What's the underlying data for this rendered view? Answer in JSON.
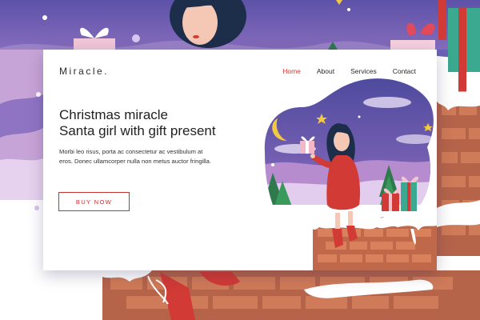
{
  "site": {
    "brand": "Miracle."
  },
  "nav": {
    "items": [
      {
        "label": "Home",
        "active": true
      },
      {
        "label": "About",
        "active": false
      },
      {
        "label": "Services",
        "active": false
      },
      {
        "label": "Contact",
        "active": false
      }
    ]
  },
  "hero": {
    "title_line1": "Christmas miracle",
    "title_line2": "Santa girl with gift present",
    "description": "Morbi leo risus, porta ac consectetur ac vestibulum at eros. Donec ullamcorper nulla non metus auctor fringilla.",
    "cta_label": "BUY NOW"
  },
  "colors": {
    "accent": "#d13a35",
    "sky": "#5f56a8",
    "brick": "#c46c4a"
  }
}
